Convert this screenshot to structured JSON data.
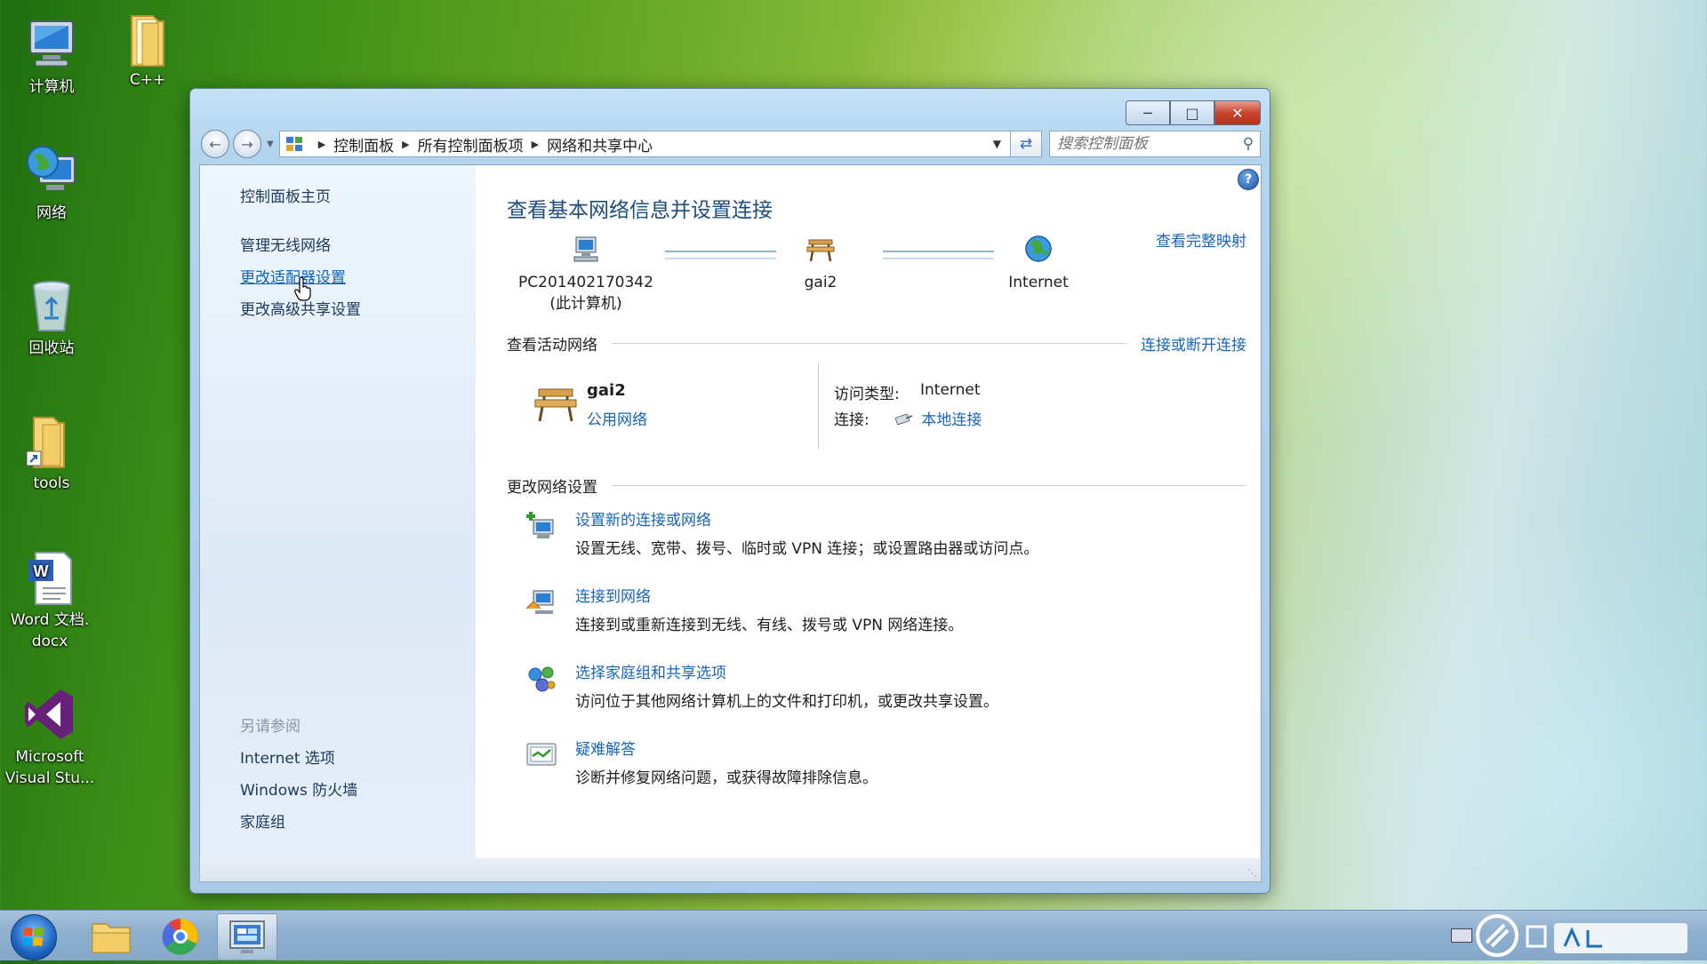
{
  "desktop": {
    "icons": [
      {
        "label": "计算机",
        "icon": "computer-icon"
      },
      {
        "label": "C++",
        "icon": "folder-icon"
      },
      {
        "label": "网络",
        "icon": "network-globe-icon"
      },
      {
        "label": "回收站",
        "icon": "recycle-bin-icon"
      },
      {
        "label": "tools",
        "icon": "folder-shortcut-icon"
      },
      {
        "label": "Word 文档.",
        "label2": "docx",
        "icon": "word-document-icon"
      },
      {
        "label": "Microsoft",
        "label2": "Visual Stu...",
        "icon": "visual-studio-icon"
      }
    ]
  },
  "window": {
    "breadcrumb": [
      "控制面板",
      "所有控制面板项",
      "网络和共享中心"
    ],
    "search_placeholder": "搜索控制面板",
    "sidebar": {
      "home": "控制面板主页",
      "items": [
        "管理无线网络",
        "更改适配器设置",
        "更改高级共享设置"
      ],
      "see_also_title": "另请参阅",
      "see_also": [
        "Internet 选项",
        "Windows 防火墙",
        "家庭组"
      ]
    },
    "main": {
      "title": "查看基本网络信息并设置连接",
      "full_map_link": "查看完整映射",
      "map": {
        "computer": {
          "name": "PC201402170342",
          "sub": "(此计算机)"
        },
        "network": {
          "name": "gai2"
        },
        "internet": {
          "name": "Internet"
        }
      },
      "active_networks": {
        "title": "查看活动网络",
        "link": "连接或断开连接",
        "network_name": "gai2",
        "network_type": "公用网络",
        "access_type_label": "访问类型:",
        "access_type_value": "Internet",
        "connection_label": "连接:",
        "connection_value": "本地连接"
      },
      "change_settings": {
        "title": "更改网络设置",
        "tasks": [
          {
            "link": "设置新的连接或网络",
            "desc": "设置无线、宽带、拨号、临时或 VPN 连接；或设置路由器或访问点。"
          },
          {
            "link": "连接到网络",
            "desc": "连接到或重新连接到无线、有线、拨号或 VPN 网络连接。"
          },
          {
            "link": "选择家庭组和共享选项",
            "desc": "访问位于其他网络计算机上的文件和打印机，或更改共享设置。"
          },
          {
            "link": "疑难解答",
            "desc": "诊断并修复网络问题，或获得故障排除信息。"
          }
        ]
      }
    }
  }
}
